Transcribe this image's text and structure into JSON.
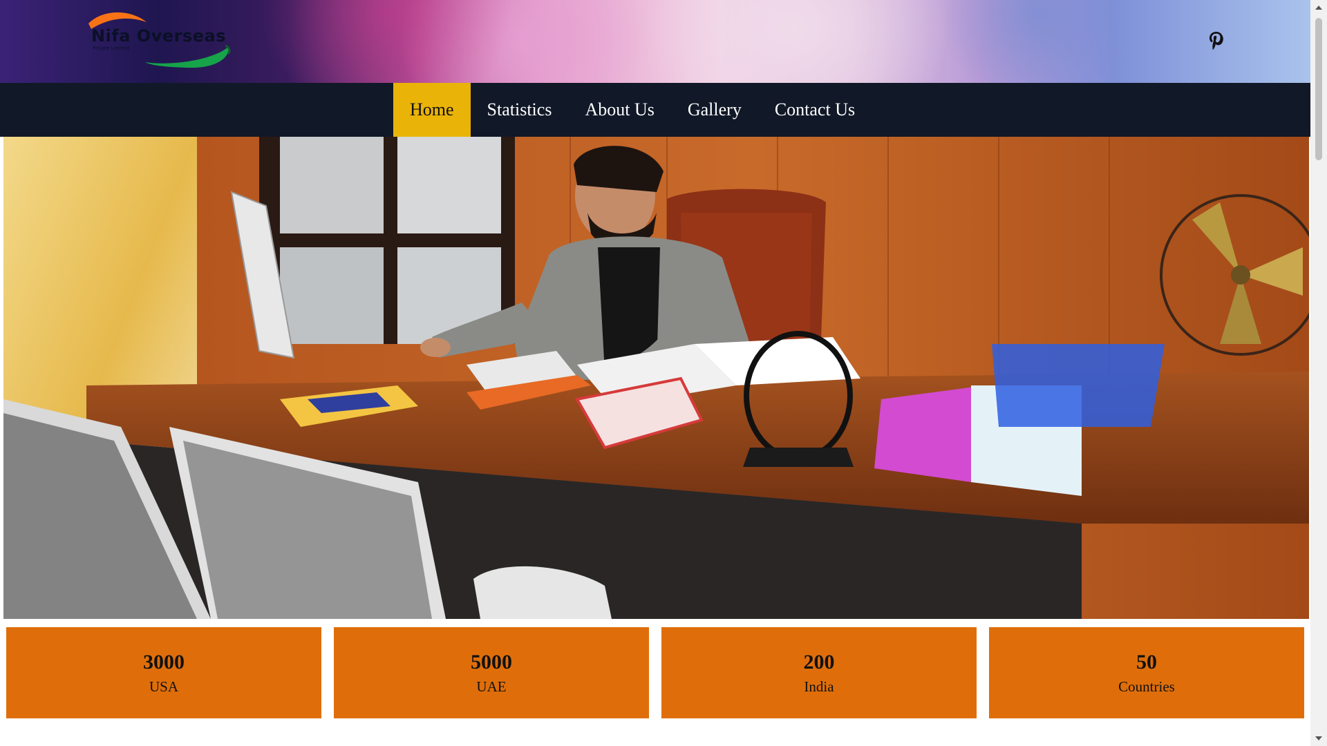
{
  "brand": {
    "name": "Nifa Overseas",
    "tagline": "Private Limited",
    "colors": {
      "swoosh_orange": "#f97316",
      "swoosh_green": "#16a34a"
    }
  },
  "header": {
    "social_icon": "pinterest-icon"
  },
  "nav": {
    "items": [
      {
        "label": "Home",
        "active": true
      },
      {
        "label": "Statistics",
        "active": false
      },
      {
        "label": "About Us",
        "active": false
      },
      {
        "label": "Gallery",
        "active": false
      },
      {
        "label": "Contact Us",
        "active": false
      }
    ],
    "colors": {
      "background": "#111827",
      "active": "#eab308"
    }
  },
  "hero": {
    "alt": "Man working at a desk in an office"
  },
  "stats": [
    {
      "value": "3000",
      "label": "USA"
    },
    {
      "value": "5000",
      "label": "UAE"
    },
    {
      "value": "200",
      "label": "India"
    },
    {
      "value": "50",
      "label": "Countries"
    }
  ],
  "stats_color": "#df6e0a"
}
